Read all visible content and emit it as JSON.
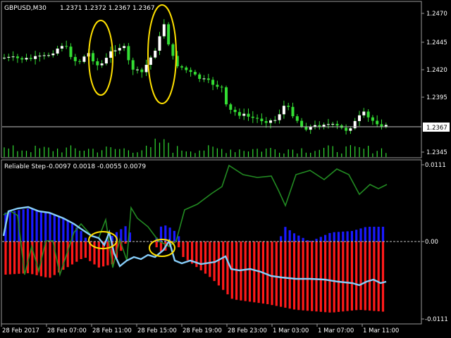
{
  "main_chart": {
    "title": "GBPUSD,M30",
    "ohlc_text": "1.2371 1.2372 1.2367 1.2367",
    "current_price": "1.2367",
    "price_ticks": [
      "1.2470",
      "1.2445",
      "1.2420",
      "1.2395",
      "1.2370",
      "1.2345"
    ],
    "colors": {
      "bull": "#ffffff",
      "bear": "#33dd33",
      "wick": "#33dd33",
      "volume": "#33dd33",
      "price_line": "#bfbfbf",
      "annotation": "#ffe000",
      "border": "#9a9a9a"
    }
  },
  "indicator": {
    "title": "Reliable Step",
    "values_text": "-0.0097 0.0018 -0.0055 0.0079",
    "ticks": [
      "0.0111",
      "0.00",
      "-0.0111"
    ],
    "colors": {
      "positive": "#1a1aff",
      "negative": "#ff1a1a",
      "signal": "#228b22",
      "step": "#87cefa",
      "zero": "#bfbfbf"
    }
  },
  "time_axis": {
    "labels": [
      "28 Feb 2017",
      "28 Feb 07:00",
      "28 Feb 11:00",
      "28 Feb 15:00",
      "28 Feb 19:00",
      "28 Feb 23:00",
      "1 Mar 03:00",
      "1 Mar 07:00",
      "1 Mar 11:00"
    ]
  },
  "chart_data": [
    {
      "type": "candlestick",
      "title": "GBPUSD,M30",
      "x": [
        "28 Feb 2017",
        "28 Feb 07:00",
        "28 Feb 11:00",
        "28 Feb 15:00",
        "28 Feb 19:00",
        "28 Feb 23:00",
        "1 Mar 03:00",
        "1 Mar 07:00",
        "1 Mar 11:00"
      ],
      "ylim": [
        1.234,
        1.2485
      ],
      "close_estimates": [
        1.243,
        1.2438,
        1.2445,
        1.2425,
        1.244,
        1.2465,
        1.24,
        1.2376,
        1.2378,
        1.2367
      ],
      "last": 1.2367
    },
    {
      "type": "bar",
      "title": "Reliable Step",
      "ylim": [
        -0.0111,
        0.0111
      ],
      "last_values": [
        -0.0097,
        0.0018,
        -0.0055,
        0.0079
      ]
    }
  ]
}
